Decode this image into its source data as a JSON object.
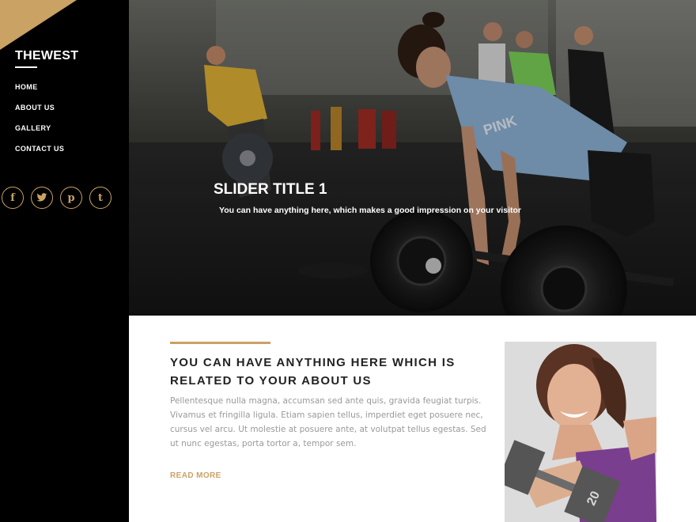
{
  "site": {
    "logo": "THEWEST"
  },
  "nav": {
    "items": [
      {
        "label": "HOME"
      },
      {
        "label": "ABOUT US"
      },
      {
        "label": "GALLERY"
      },
      {
        "label": "CONTACT US"
      }
    ]
  },
  "social": [
    {
      "icon": "facebook-icon",
      "glyph": "f"
    },
    {
      "icon": "twitter-icon",
      "glyph": "t"
    },
    {
      "icon": "pinterest-icon",
      "glyph": "p"
    },
    {
      "icon": "tumblr-icon",
      "glyph": "t"
    }
  ],
  "slider": {
    "title": "SLIDER TITLE 1",
    "subtitle": "You can have anything here, which makes a good impression on your visitor",
    "shirt_text": "PINK"
  },
  "about": {
    "heading": "YOU CAN HAVE ANYTHING HERE WHICH IS RELATED TO YOUR ABOUT US",
    "body": "Pellentesque nulla magna, accumsan sed ante quis, gravida feugiat turpis. Vivamus et fringilla ligula. Etiam sapien tellus, imperdiet eget posuere nec, cursus vel arcu. Ut molestie at posuere ante, at volutpat tellus egestas. Sed ut nunc egestas, porta tortor a, tempor sem.",
    "read_more": "READ MORE",
    "dumbbell_label": "20"
  },
  "colors": {
    "accent": "#c9a264",
    "sidebar": "#000000"
  }
}
